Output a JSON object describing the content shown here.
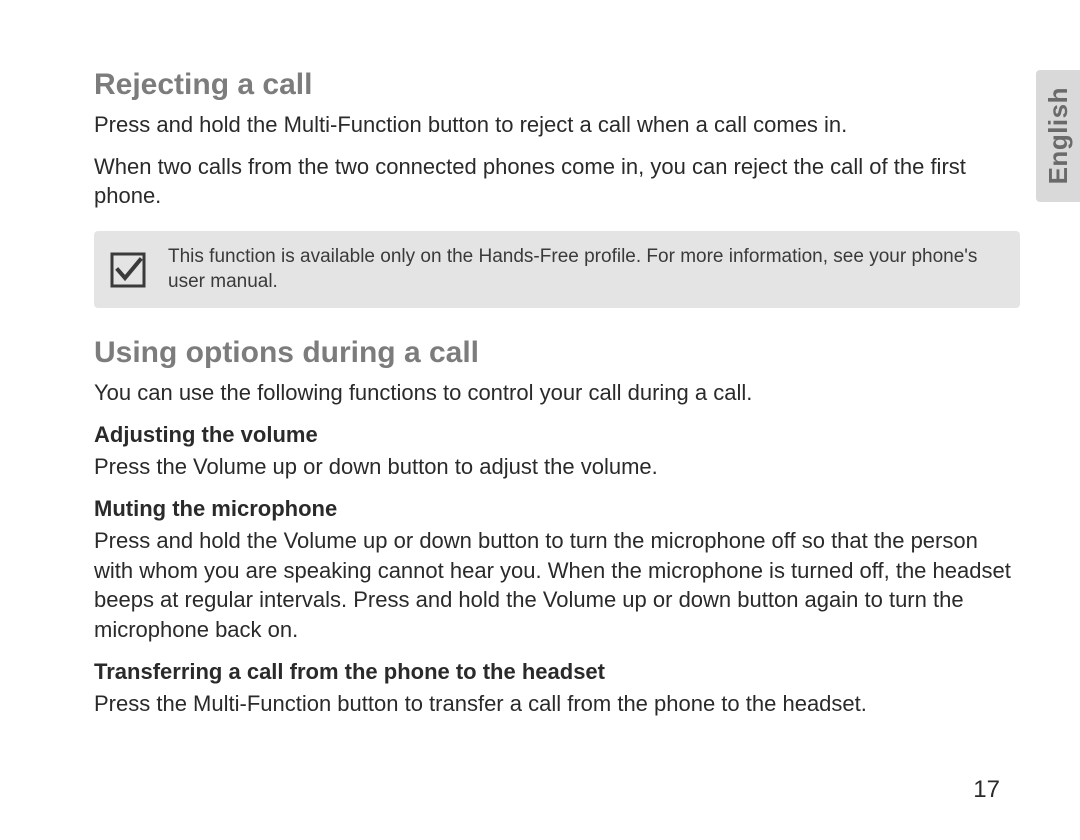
{
  "language_tab": "English",
  "section1": {
    "heading": "Rejecting a call",
    "p1": "Press and hold the Multi-Function button to reject a call when a call comes in.",
    "p2": "When two calls from the two connected phones come in, you can reject the call of the first phone."
  },
  "note": {
    "text": "This function is available only on the Hands-Free profile. For more information, see your phone's user manual."
  },
  "section2": {
    "heading": "Using options during a call",
    "intro": "You can use the following functions to control your call during a call.",
    "sub1": {
      "heading": "Adjusting the volume",
      "body": "Press the Volume up or down button to adjust the volume."
    },
    "sub2": {
      "heading": "Muting the microphone",
      "body": "Press and hold the Volume up or down button to turn the microphone off so that the person with whom you are speaking cannot hear you. When the microphone is turned off, the headset beeps at regular intervals. Press and hold the Volume up or down button again to turn the microphone back on."
    },
    "sub3": {
      "heading": "Transferring a call from the phone to the headset",
      "body": "Press the Multi-Function button to transfer a call from the phone to the headset."
    }
  },
  "page_number": "17"
}
